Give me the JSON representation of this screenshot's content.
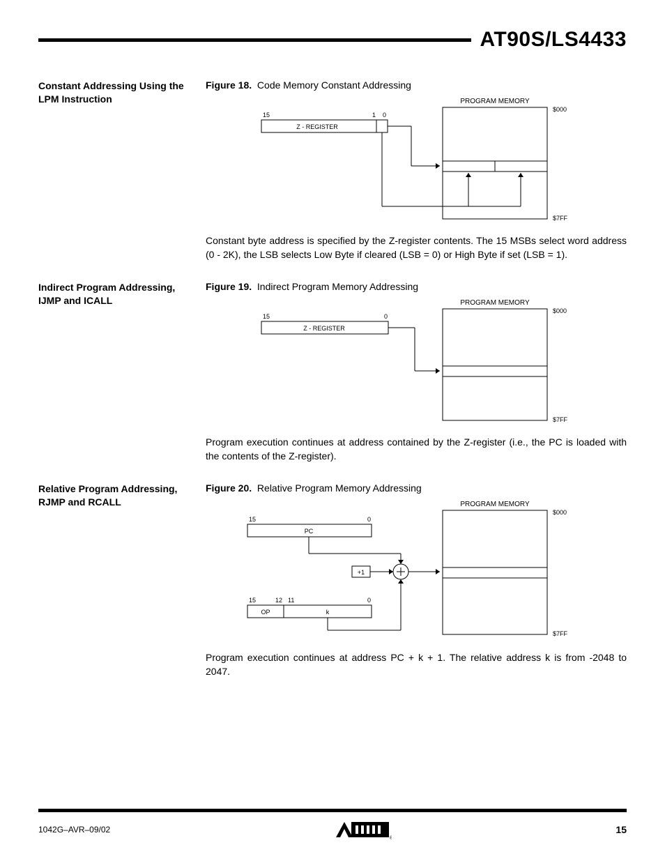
{
  "doc_title": "AT90S/LS4433",
  "sections": [
    {
      "heading": "Constant Addressing Using the LPM Instruction",
      "figure_label": "Figure 18.",
      "figure_title": "Code Memory Constant Addressing",
      "diagram": {
        "mem_label": "PROGRAM MEMORY",
        "addr_top": "$000",
        "addr_bot": "$7FF",
        "reg_label": "Z - REGISTER",
        "bit_hi": "15",
        "bit_mid": "1",
        "bit_lo": "0"
      },
      "body": "Constant byte address is specified by the Z-register contents. The 15 MSBs select word address (0 - 2K), the LSB selects Low Byte if cleared (LSB = 0) or High Byte if set (LSB = 1)."
    },
    {
      "heading": "Indirect Program Addressing, IJMP and ICALL",
      "figure_label": "Figure 19.",
      "figure_title": "Indirect Program Memory Addressing",
      "diagram": {
        "mem_label": "PROGRAM MEMORY",
        "addr_top": "$000",
        "addr_bot": "$7FF",
        "reg_label": "Z - REGISTER",
        "bit_hi": "15",
        "bit_lo": "0"
      },
      "body": "Program execution continues at address contained by the Z-register (i.e., the PC is loaded with the contents of the Z-register)."
    },
    {
      "heading": "Relative Program Addressing, RJMP and RCALL",
      "figure_label": "Figure 20.",
      "figure_title": "Relative Program Memory Addressing",
      "diagram": {
        "mem_label": "PROGRAM MEMORY",
        "addr_top": "$000",
        "addr_bot": "$7FF",
        "pc_label": "PC",
        "pc_hi": "15",
        "pc_lo": "0",
        "op_label": "OP",
        "k_label": "k",
        "op_hi": "15",
        "op_mid1": "12",
        "op_mid2": "11",
        "op_lo": "0",
        "plus1": "+1"
      },
      "body": "Program execution continues at address PC + k + 1. The relative address k is from -2048 to 2047."
    }
  ],
  "footer": {
    "doc_code": "1042G–AVR–09/02",
    "page": "15",
    "logo": "ATMEL"
  }
}
